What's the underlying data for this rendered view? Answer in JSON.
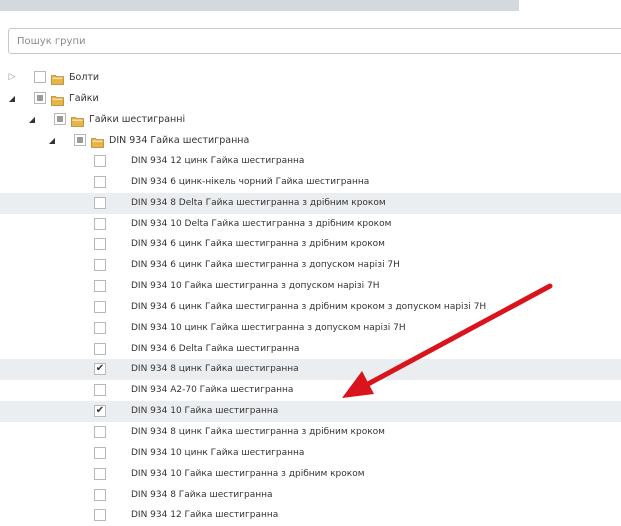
{
  "search": {
    "placeholder": "Пошук групи"
  },
  "tree": [
    {
      "label": "Болти",
      "level": 0,
      "expand": "closed",
      "check": "none",
      "folder": true
    },
    {
      "label": "Гайки",
      "level": 0,
      "expand": "open",
      "check": "partial",
      "folder": true
    },
    {
      "label": "Гайки шестигранні",
      "level": 1,
      "expand": "open",
      "check": "partial",
      "folder": true
    },
    {
      "label": "DIN 934 Гайка шестигранна",
      "level": 2,
      "expand": "open",
      "check": "partial",
      "folder": true
    }
  ],
  "items": [
    {
      "label": "DIN 934 12 цинк Гайка шестигранна",
      "checked": false,
      "shaded": false
    },
    {
      "label": "DIN 934 6 цинк-нікель чорний Гайка шестигранна",
      "checked": false,
      "shaded": false
    },
    {
      "label": "DIN 934 8 Delta Гайка шестигранна з дрібним кроком",
      "checked": false,
      "shaded": true
    },
    {
      "label": "DIN 934 10 Delta Гайка шестигранна з дрібним кроком",
      "checked": false,
      "shaded": false
    },
    {
      "label": "DIN 934 6 цинк Гайка шестигранна з дрібним кроком",
      "checked": false,
      "shaded": false
    },
    {
      "label": "DIN 934 6 цинк Гайка шестигранна з допуском нарізі 7H",
      "checked": false,
      "shaded": false
    },
    {
      "label": "DIN 934 10 Гайка шестигранна з допуском нарізі 7H",
      "checked": false,
      "shaded": false
    },
    {
      "label": "DIN 934 6 цинк Гайка шестигранна з дрібним кроком з допуском нарізі 7H",
      "checked": false,
      "shaded": false
    },
    {
      "label": "DIN 934 10 цинк Гайка шестигранна з допуском нарізі 7H",
      "checked": false,
      "shaded": false
    },
    {
      "label": "DIN 934 6 Delta Гайка шестигранна",
      "checked": false,
      "shaded": false
    },
    {
      "label": "DIN 934 8 цинк Гайка шестигранна",
      "checked": true,
      "shaded": true
    },
    {
      "label": "DIN 934 A2-70 Гайка шестигранна",
      "checked": false,
      "shaded": false
    },
    {
      "label": "DIN 934 10 Гайка шестигранна",
      "checked": true,
      "shaded": true
    },
    {
      "label": "DIN 934 8 цинк Гайка шестигранна з дрібним кроком",
      "checked": false,
      "shaded": false
    },
    {
      "label": "DIN 934 10 цинк Гайка шестигранна",
      "checked": false,
      "shaded": false
    },
    {
      "label": "DIN 934 10 Гайка шестигранна з дрібним кроком",
      "checked": false,
      "shaded": false
    },
    {
      "label": "DIN 934 8 Гайка шестигранна",
      "checked": false,
      "shaded": false
    },
    {
      "label": "DIN 934 12 Гайка шестигранна",
      "checked": false,
      "shaded": false
    }
  ],
  "colors": {
    "row_shade": "#ebeef1",
    "folder": "#e8b44a",
    "arrow": "#d9141c"
  },
  "icons": {
    "expand_open": "triangle-down-icon",
    "expand_closed": "triangle-right-icon",
    "folder": "folder-icon",
    "check": "checkmark-icon"
  }
}
